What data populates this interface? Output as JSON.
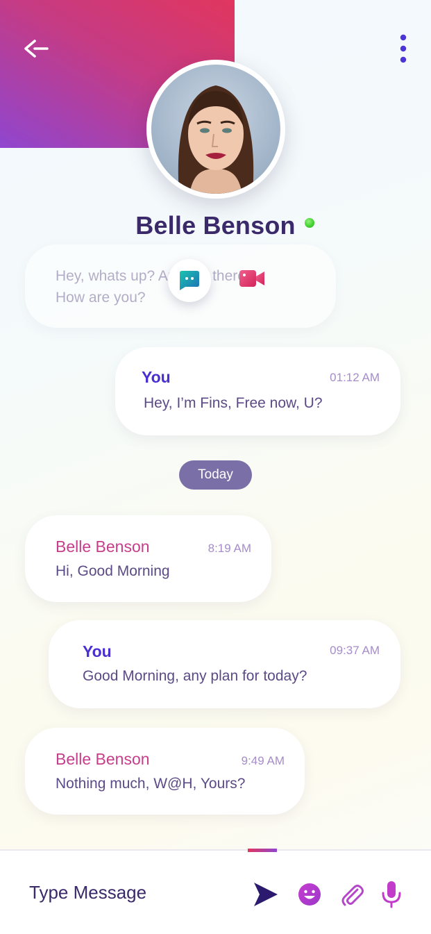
{
  "contact": {
    "name": "Belle Benson",
    "status": "online"
  },
  "faded_message": {
    "text": "Hey, whats up? Are you there?\nHow are you?"
  },
  "messages": [
    {
      "sender": "You",
      "time": "01:12 AM",
      "text": "Hey, I’m Fins, Free now, U?"
    },
    {
      "sender": "Belle Benson",
      "time": "8:19 AM",
      "text": "Hi, Good Morning"
    },
    {
      "sender": "You",
      "time": "09:37 AM",
      "text": "Good Morning, any plan for today?"
    },
    {
      "sender": "Belle Benson",
      "time": "9:49 AM",
      "text": "Nothing much, W@H, Yours?"
    }
  ],
  "day_separator": "Today",
  "composer": {
    "placeholder": "Type Message"
  },
  "icons": {
    "back": "back-arrow-icon",
    "more": "more-vertical-icon",
    "chat": "chat-bubble-icon",
    "video": "video-camera-icon",
    "send": "send-icon",
    "emoji": "emoji-icon",
    "attach": "paperclip-icon",
    "mic": "microphone-icon"
  },
  "colors": {
    "header_gradient_start": "#e1365e",
    "header_gradient_end": "#8f46cf",
    "self_sender": "#4a2fd1",
    "other_sender": "#c63e8b",
    "online": "#3fcf2c",
    "day_pill": "#7b6fa7"
  }
}
